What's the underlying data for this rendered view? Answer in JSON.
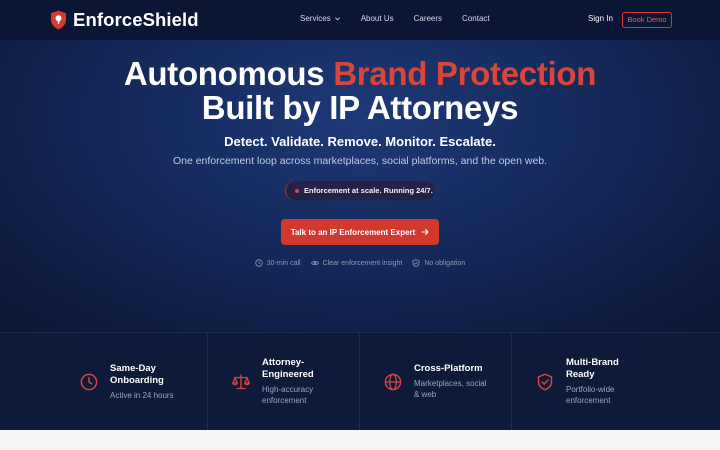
{
  "nav": {
    "brand": "EnforceShield",
    "links": [
      "Services",
      "About Us",
      "Careers",
      "Contact"
    ],
    "sign_in": "Sign In",
    "book_demo": "Book Demo"
  },
  "hero": {
    "headline_part1": "Autonomous ",
    "headline_accent": "Brand Protection",
    "headline_line2": "Built by IP Attorneys",
    "tagline": "Detect. Validate. Remove. Monitor. Escalate.",
    "subtitle": "One enforcement loop across marketplaces, social platforms, and the open web.",
    "pill": "Enforcement at scale. Running 24/7.",
    "cta": "Talk to an IP Enforcement Expert",
    "meta": [
      "30-min call",
      "Clear enforcement insight",
      "No obligation"
    ]
  },
  "features": [
    {
      "title_l1": "Same-Day",
      "title_l2": "Onboarding",
      "desc_l1": "Active in 24 hours",
      "desc_l2": "",
      "icon": "clock-icon"
    },
    {
      "title_l1": "Attorney-",
      "title_l2": "Engineered",
      "desc_l1": "High-accuracy",
      "desc_l2": "enforcement",
      "icon": "scales-icon"
    },
    {
      "title_l1": "Cross-Platform",
      "title_l2": "",
      "desc_l1": "Marketplaces, social",
      "desc_l2": "& web",
      "icon": "globe-icon"
    },
    {
      "title_l1": "Multi-Brand",
      "title_l2": "Ready",
      "desc_l1": "Portfolio-wide",
      "desc_l2": "enforcement",
      "icon": "shield-check-icon"
    }
  ],
  "colors": {
    "accent": "#d8463b",
    "nav_bg": "#0b1634",
    "hero_bg": "#15295a",
    "features_bg": "#0e1a3a"
  }
}
